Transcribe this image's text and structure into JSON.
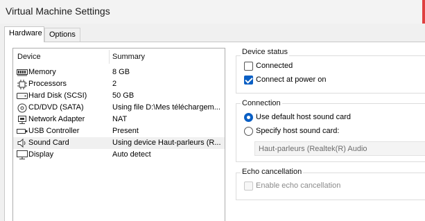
{
  "window": {
    "title": "Virtual Machine Settings"
  },
  "tabs": [
    {
      "label": "Hardware",
      "active": true
    },
    {
      "label": "Options",
      "active": false
    }
  ],
  "device_list": {
    "headers": {
      "device": "Device",
      "summary": "Summary"
    },
    "rows": [
      {
        "name": "Memory",
        "summary": "8 GB",
        "icon": "memory-icon"
      },
      {
        "name": "Processors",
        "summary": "2",
        "icon": "processor-icon"
      },
      {
        "name": "Hard Disk (SCSI)",
        "summary": "50 GB",
        "icon": "hard-disk-icon"
      },
      {
        "name": "CD/DVD (SATA)",
        "summary": "Using file D:\\Mes téléchargem...",
        "icon": "cd-dvd-icon"
      },
      {
        "name": "Network Adapter",
        "summary": "NAT",
        "icon": "network-adapter-icon"
      },
      {
        "name": "USB Controller",
        "summary": "Present",
        "icon": "usb-controller-icon"
      },
      {
        "name": "Sound Card",
        "summary": "Using device Haut-parleurs (R...",
        "icon": "sound-card-icon",
        "selected": true
      },
      {
        "name": "Display",
        "summary": "Auto detect",
        "icon": "display-icon"
      }
    ]
  },
  "device_status": {
    "title": "Device status",
    "connected": {
      "label": "Connected",
      "checked": false
    },
    "connect_at_power_on": {
      "label": "Connect at power on",
      "checked": true
    }
  },
  "connection": {
    "title": "Connection",
    "use_default": {
      "label": "Use default host sound card",
      "selected": true
    },
    "specify": {
      "label": "Specify host sound card:",
      "selected": false
    },
    "sound_card_select": {
      "value": "Haut-parleurs (Realtek(R) Audio"
    }
  },
  "echo_cancellation": {
    "title": "Echo cancellation",
    "enable": {
      "label": "Enable echo cancellation",
      "checked": false,
      "disabled": true
    }
  },
  "colors": {
    "accent": "#0a5fc4",
    "selected_row": "#f0f0f0"
  }
}
